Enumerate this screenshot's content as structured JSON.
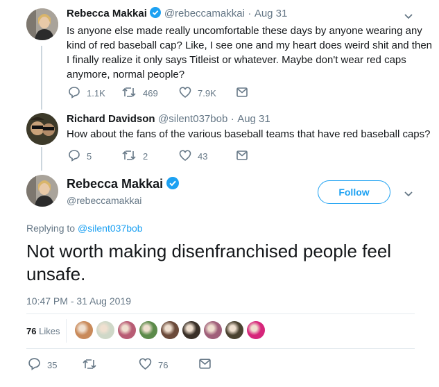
{
  "thread": [
    {
      "name": "Rebecca Makkai",
      "handle": "@rebeccamakkai",
      "sep": "·",
      "date": "Aug 31",
      "text": "Is anyone else made really uncomfortable these days by anyone wearing any kind of red baseball cap? Like, I see one and my heart does weird shit and then I finally realize it only says Titleist or whatever. Maybe don't wear red caps anymore, normal people?",
      "replies": "1.1K",
      "retweets": "469",
      "likes": "7.9K",
      "verified": true
    },
    {
      "name": "Richard Davidson",
      "handle": "@silent037bob",
      "sep": "·",
      "date": "Aug 31",
      "text": "How about the fans of the various baseball teams that have red baseball caps?",
      "replies": "5",
      "retweets": "2",
      "likes": "43",
      "verified": false
    }
  ],
  "main": {
    "name": "Rebecca Makkai",
    "handle": "@rebeccamakkai",
    "follow_label": "Follow",
    "replying_prefix": "Replying to",
    "replying_to": "@silent037bob",
    "text": "Not worth making disenfranchised people feel unsafe.",
    "timestamp": "10:47 PM - 31 Aug 2019",
    "likes_count": "76",
    "likes_label": "Likes",
    "liker_colors": [
      "#c98a5a",
      "#cfd8c8",
      "#b85c74",
      "#5c8a4a",
      "#6b4a3a",
      "#3a3028",
      "#a0607a",
      "#4a4230",
      "#d6267a"
    ],
    "replies": "35",
    "retweets": "",
    "likes": "76"
  },
  "colors": {
    "accent": "#1da1f2",
    "verified": "#1da1f2",
    "muted": "#657786",
    "line": "#ccd6dd"
  },
  "icons": [
    "reply-icon",
    "retweet-icon",
    "like-icon",
    "message-icon",
    "verified-icon",
    "chevron-down-icon"
  ]
}
